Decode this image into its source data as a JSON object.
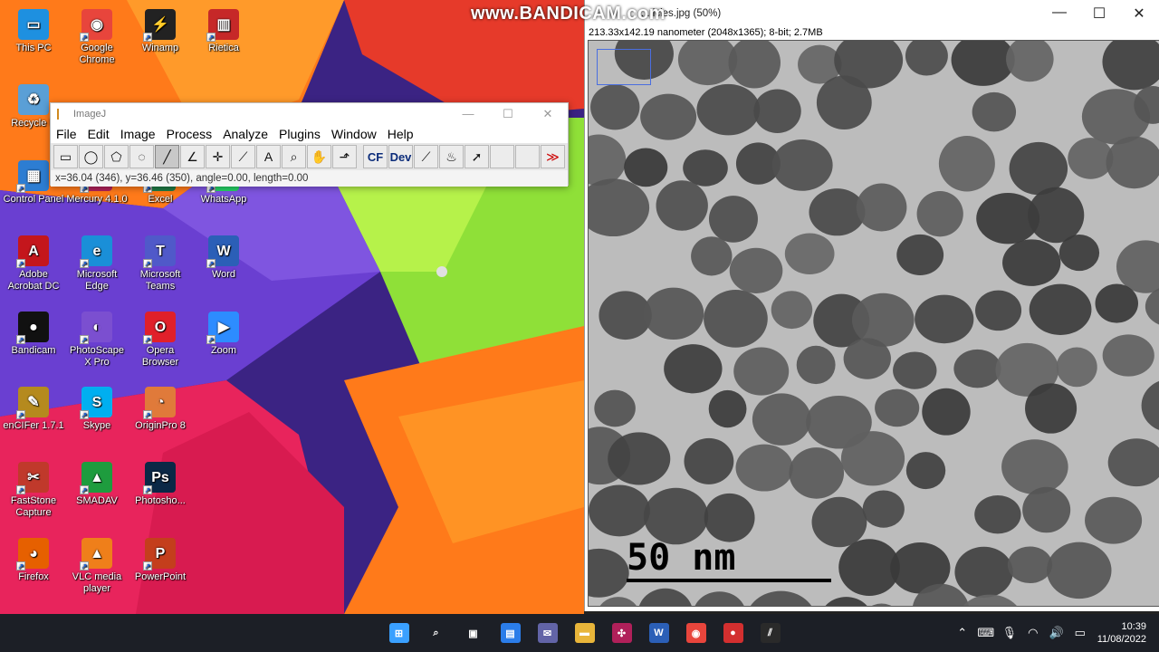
{
  "watermark": "www.BANDICAM.com",
  "desktop_icons": [
    {
      "id": "this-pc",
      "label": "This PC",
      "color": "#1e90e0",
      "glyph": "▭"
    },
    {
      "id": "google-chrome",
      "label": "Google Chrome",
      "color": "#e8453c",
      "glyph": "◉"
    },
    {
      "id": "winamp",
      "label": "Winamp",
      "color": "#222222",
      "glyph": "⚡"
    },
    {
      "id": "rietica",
      "label": "Rietica",
      "color": "#c62828",
      "glyph": "▥"
    },
    {
      "id": "recycle-bin",
      "label": "Recycle B",
      "color": "#5a9fd6",
      "glyph": "♻"
    },
    {
      "id": "control-panel",
      "label": "Control Panel",
      "color": "#2d7dd2",
      "glyph": "▦"
    },
    {
      "id": "mercury",
      "label": "Mercury 4.1.0",
      "color": "#b0205a",
      "glyph": "✣"
    },
    {
      "id": "excel",
      "label": "Excel",
      "color": "#1f7a45",
      "glyph": "X"
    },
    {
      "id": "whatsapp",
      "label": "WhatsApp",
      "color": "#25d366",
      "glyph": "✆"
    },
    {
      "id": "adobe-acrobat",
      "label": "Adobe Acrobat DC",
      "color": "#c4161c",
      "glyph": "A"
    },
    {
      "id": "microsoft-edge",
      "label": "Microsoft Edge",
      "color": "#1a8fd8",
      "glyph": "e"
    },
    {
      "id": "microsoft-teams",
      "label": "Microsoft Teams",
      "color": "#5059c9",
      "glyph": "T"
    },
    {
      "id": "word",
      "label": "Word",
      "color": "#2b5fb7",
      "glyph": "W"
    },
    {
      "id": "bandicam",
      "label": "Bandicam",
      "color": "#111111",
      "glyph": "●"
    },
    {
      "id": "photoscape",
      "label": "PhotoScape X Pro",
      "color": "#7b4fd0",
      "glyph": "◐"
    },
    {
      "id": "opera",
      "label": "Opera Browser",
      "color": "#e0202a",
      "glyph": "O"
    },
    {
      "id": "zoom",
      "label": "Zoom",
      "color": "#2d8cff",
      "glyph": "▶"
    },
    {
      "id": "encifer",
      "label": "enCIFer 1.7.1",
      "color": "#b58a1e",
      "glyph": "✎"
    },
    {
      "id": "skype",
      "label": "Skype",
      "color": "#00aff0",
      "glyph": "S"
    },
    {
      "id": "originpro",
      "label": "OriginPro 8",
      "color": "#e07a3a",
      "glyph": "◔"
    },
    {
      "id": "faststone",
      "label": "FastStone Capture",
      "color": "#c0392b",
      "glyph": "✂"
    },
    {
      "id": "smadav",
      "label": "SMADAV",
      "color": "#1e9c3e",
      "glyph": "▲"
    },
    {
      "id": "photoshop",
      "label": "Photosho...",
      "color": "#0b2846",
      "glyph": "Ps"
    },
    {
      "id": "firefox",
      "label": "Firefox",
      "color": "#e66000",
      "glyph": "◕"
    },
    {
      "id": "vlc",
      "label": "VLC media player",
      "color": "#ef7f1a",
      "glyph": "▲"
    },
    {
      "id": "powerpoint",
      "label": "PowerPoint",
      "color": "#c43e1c",
      "glyph": "P"
    }
  ],
  "imagej": {
    "title": "ImageJ",
    "menu": [
      "File",
      "Edit",
      "Image",
      "Process",
      "Analyze",
      "Plugins",
      "Window",
      "Help"
    ],
    "tools": [
      {
        "id": "rectangle-tool",
        "glyph": "▭"
      },
      {
        "id": "oval-tool",
        "glyph": "◯"
      },
      {
        "id": "polygon-tool",
        "glyph": "⬠"
      },
      {
        "id": "freehand-tool",
        "glyph": "◌"
      },
      {
        "id": "line-tool",
        "glyph": "╱",
        "selected": true
      },
      {
        "id": "angle-tool",
        "glyph": "∠"
      },
      {
        "id": "point-tool",
        "glyph": "✛"
      },
      {
        "id": "wand-tool",
        "glyph": "⟋"
      },
      {
        "id": "text-tool",
        "glyph": "A"
      },
      {
        "id": "zoom-tool",
        "glyph": "⌕"
      },
      {
        "id": "hand-tool",
        "glyph": "✋"
      },
      {
        "id": "dropper-tool",
        "glyph": "⬏"
      },
      {
        "id": "cf-tool",
        "glyph": "CF",
        "gap": true
      },
      {
        "id": "dev-tool",
        "glyph": "Dev"
      },
      {
        "id": "brush-tool",
        "glyph": "⟋"
      },
      {
        "id": "flood-tool",
        "glyph": "♨"
      },
      {
        "id": "arrow-tool",
        "glyph": "➚"
      },
      {
        "id": "blank-tool-1",
        "glyph": ""
      },
      {
        "id": "blank-tool-2",
        "glyph": ""
      },
      {
        "id": "more-tools",
        "glyph": "≫"
      }
    ],
    "status": "x=36.04 (346), y=36.46 (350), angle=0.00, length=0.00"
  },
  "image_window": {
    "title": "...ticles.jpg (50%)",
    "info": "213.33x142.19 nanometer (2048x1365); 8-bit; 2.7MB",
    "scale_label": "50 nm"
  },
  "taskbar": {
    "apps": [
      {
        "id": "start",
        "glyph": "⊞",
        "color": "#3aa0ff"
      },
      {
        "id": "search",
        "glyph": "⌕",
        "color": "#1c1f26"
      },
      {
        "id": "task-view",
        "glyph": "▣",
        "color": "#1c1f26"
      },
      {
        "id": "widgets",
        "glyph": "▤",
        "color": "#2b7de9"
      },
      {
        "id": "chat",
        "glyph": "✉",
        "color": "#6264a7"
      },
      {
        "id": "file-explorer",
        "glyph": "▬",
        "color": "#e8b53a"
      },
      {
        "id": "mercury",
        "glyph": "✣",
        "color": "#b0205a"
      },
      {
        "id": "word",
        "glyph": "W",
        "color": "#2b5fb7"
      },
      {
        "id": "chrome",
        "glyph": "◉",
        "color": "#e8453c"
      },
      {
        "id": "bandicam",
        "glyph": "●",
        "color": "#d32f2f"
      },
      {
        "id": "imagej",
        "glyph": "⫽",
        "color": "#2a2a2a"
      }
    ],
    "time": "10:39",
    "date": "11/08/2022"
  }
}
